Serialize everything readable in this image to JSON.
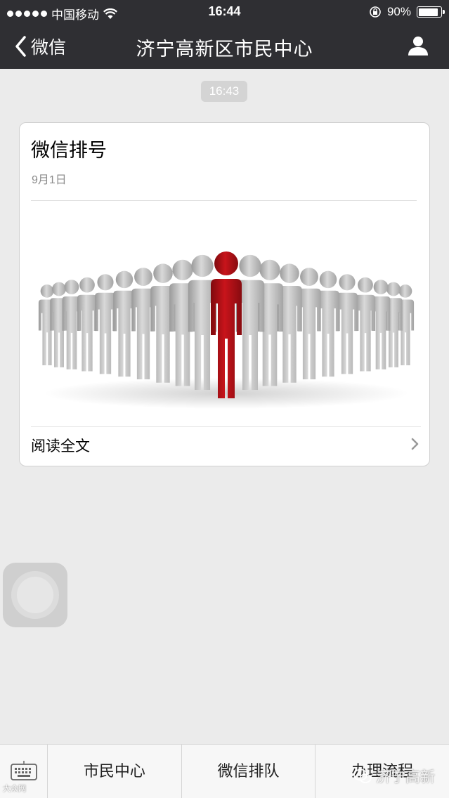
{
  "status_bar": {
    "carrier": "中国移动",
    "time": "16:44",
    "battery": "90%",
    "battery_level": 0.9
  },
  "nav": {
    "back_label": "微信",
    "title": "济宁高新区市民中心"
  },
  "chat": {
    "timestamp": "16:43",
    "card": {
      "title": "微信排号",
      "date": "9月1日",
      "read_more": "阅读全文"
    }
  },
  "bottom_menu": {
    "items": [
      "市民中心",
      "微信排队",
      "办理流程"
    ]
  },
  "watermarks": {
    "left": "大众网",
    "right": "济宁高新"
  },
  "colors": {
    "nav_bg": "#2f2f33",
    "page_bg": "#ebebeb",
    "highlight_figure": "#b51218"
  }
}
